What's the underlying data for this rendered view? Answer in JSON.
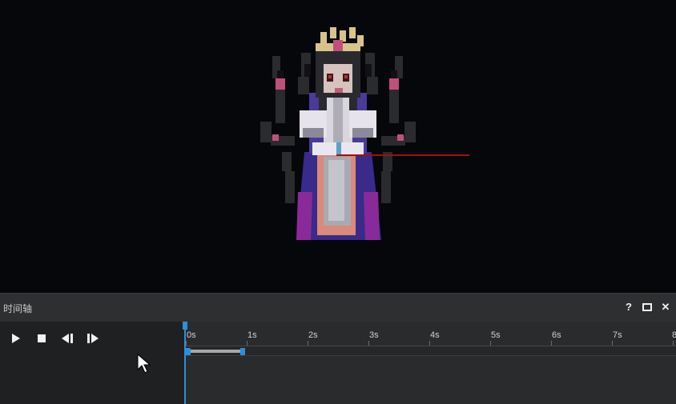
{
  "panel": {
    "title": "时间轴",
    "help_label": "?",
    "maximize_icon": "maximize-icon",
    "close_label": "✕"
  },
  "controls": {
    "play_icon": "play-icon",
    "stop_icon": "stop-icon",
    "prev_frame_icon": "step-back-icon",
    "next_frame_icon": "step-forward-icon"
  },
  "ruler": {
    "ticks": [
      "0s",
      "1s",
      "2s",
      "3s",
      "4s",
      "5s",
      "6s",
      "7s",
      "8"
    ]
  },
  "colors": {
    "accent": "#2d8fd9",
    "background": "#05070a",
    "panel": "#252628"
  }
}
